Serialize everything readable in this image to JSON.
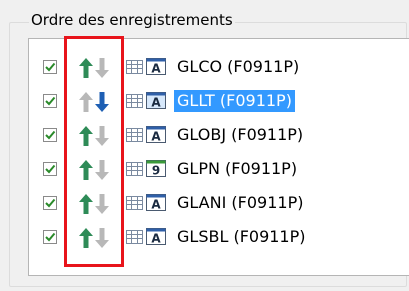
{
  "group": {
    "title": "Ordre des enregistrements"
  },
  "records": [
    {
      "label": "GLCO (F0911P)",
      "type_icon": "text-field-icon",
      "type_letter": "A",
      "checked": true,
      "up_active": true,
      "down_active": false,
      "selected": false
    },
    {
      "label": "GLLT (F0911P)",
      "type_icon": "text-field-icon",
      "type_letter": "A",
      "checked": true,
      "up_active": false,
      "down_active": true,
      "selected": true
    },
    {
      "label": "GLOBJ (F0911P)",
      "type_icon": "text-field-icon",
      "type_letter": "A",
      "checked": true,
      "up_active": true,
      "down_active": false,
      "selected": false
    },
    {
      "label": "GLPN (F0911P)",
      "type_icon": "numeric-field-icon",
      "type_letter": "9",
      "checked": true,
      "up_active": true,
      "down_active": false,
      "selected": false
    },
    {
      "label": "GLANI (F0911P)",
      "type_icon": "text-field-icon",
      "type_letter": "A",
      "checked": true,
      "up_active": true,
      "down_active": false,
      "selected": false
    },
    {
      "label": "GLSBL (F0911P)",
      "type_icon": "text-field-icon",
      "type_letter": "A",
      "checked": true,
      "up_active": true,
      "down_active": false,
      "selected": false
    }
  ],
  "colors": {
    "up_active": "#2e8b57",
    "down_active": "#1e5fb4",
    "arrow_inactive": "#b8b8b8",
    "checkmark": "#2a8a2a",
    "selection": "#3399ff",
    "highlight": "#e8141b"
  }
}
